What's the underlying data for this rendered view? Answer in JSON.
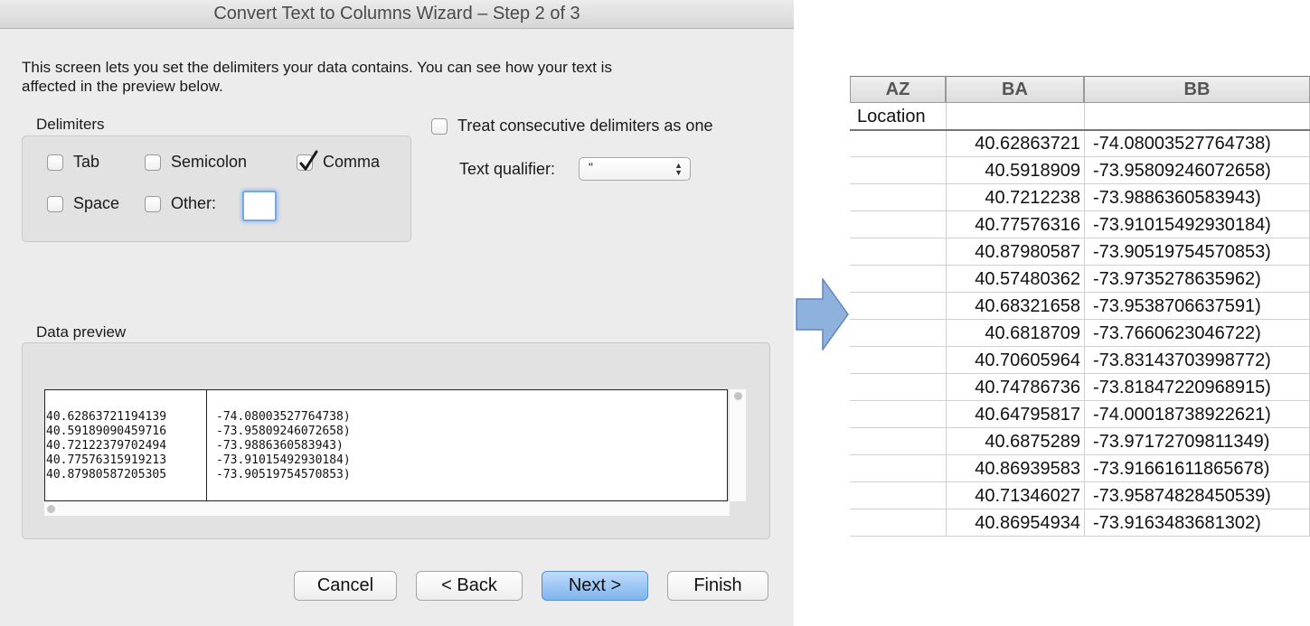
{
  "dialog": {
    "title": "Convert Text to Columns Wizard – Step 2 of 3",
    "intro": "This screen lets you set the delimiters your data contains.  You can see how your text is\naffected in the preview below.",
    "delimiters_label": "Delimiters",
    "options": {
      "tab": {
        "label": "Tab",
        "checked": false
      },
      "semicolon": {
        "label": "Semicolon",
        "checked": false
      },
      "comma": {
        "label": "Comma",
        "checked": true
      },
      "space": {
        "label": "Space",
        "checked": false
      },
      "other": {
        "label": "Other:",
        "checked": false,
        "value": ""
      }
    },
    "consecutive": {
      "label": "Treat consecutive delimiters as one",
      "checked": false
    },
    "qualifier": {
      "label": "Text qualifier:",
      "value": "\""
    },
    "preview_label": "Data preview",
    "preview_rows": [
      [
        "40.62863721194139",
        "-74.08003527764738)"
      ],
      [
        "40.59189090459716",
        "-73.95809246072658)"
      ],
      [
        "40.72122379702494",
        "-73.9886360583943)"
      ],
      [
        "40.77576315919213",
        "-73.91015492930184)"
      ],
      [
        "40.87980587205305",
        "-73.90519754570853)"
      ]
    ],
    "buttons": {
      "cancel": "Cancel",
      "back": "< Back",
      "next": "Next >",
      "finish": "Finish"
    }
  },
  "arrow": {
    "icon": "right-arrow-icon",
    "color": "#8fb2dd"
  },
  "spreadsheet": {
    "columns": [
      "AZ",
      "BA",
      "BB"
    ],
    "header_row": [
      "Location",
      "",
      ""
    ],
    "rows": [
      [
        "",
        "40.62863721",
        "-74.08003527764738)"
      ],
      [
        "",
        "40.5918909",
        "-73.95809246072658)"
      ],
      [
        "",
        "40.7212238",
        "-73.9886360583943)"
      ],
      [
        "",
        "40.77576316",
        "-73.91015492930184)"
      ],
      [
        "",
        "40.87980587",
        "-73.90519754570853)"
      ],
      [
        "",
        "40.57480362",
        "-73.9735278635962)"
      ],
      [
        "",
        "40.68321658",
        "-73.9538706637591)"
      ],
      [
        "",
        "40.6818709",
        "-73.7660623046722)"
      ],
      [
        "",
        "40.70605964",
        "-73.83143703998772)"
      ],
      [
        "",
        "40.74786736",
        "-73.81847220968915)"
      ],
      [
        "",
        "40.64795817",
        "-74.00018738922621)"
      ],
      [
        "",
        "40.6875289",
        "-73.97172709811349)"
      ],
      [
        "",
        "40.86939583",
        "-73.91661611865678)"
      ],
      [
        "",
        "40.71346027",
        "-73.95874828450539)"
      ],
      [
        "",
        "40.86954934",
        "-73.9163483681302)"
      ]
    ]
  }
}
